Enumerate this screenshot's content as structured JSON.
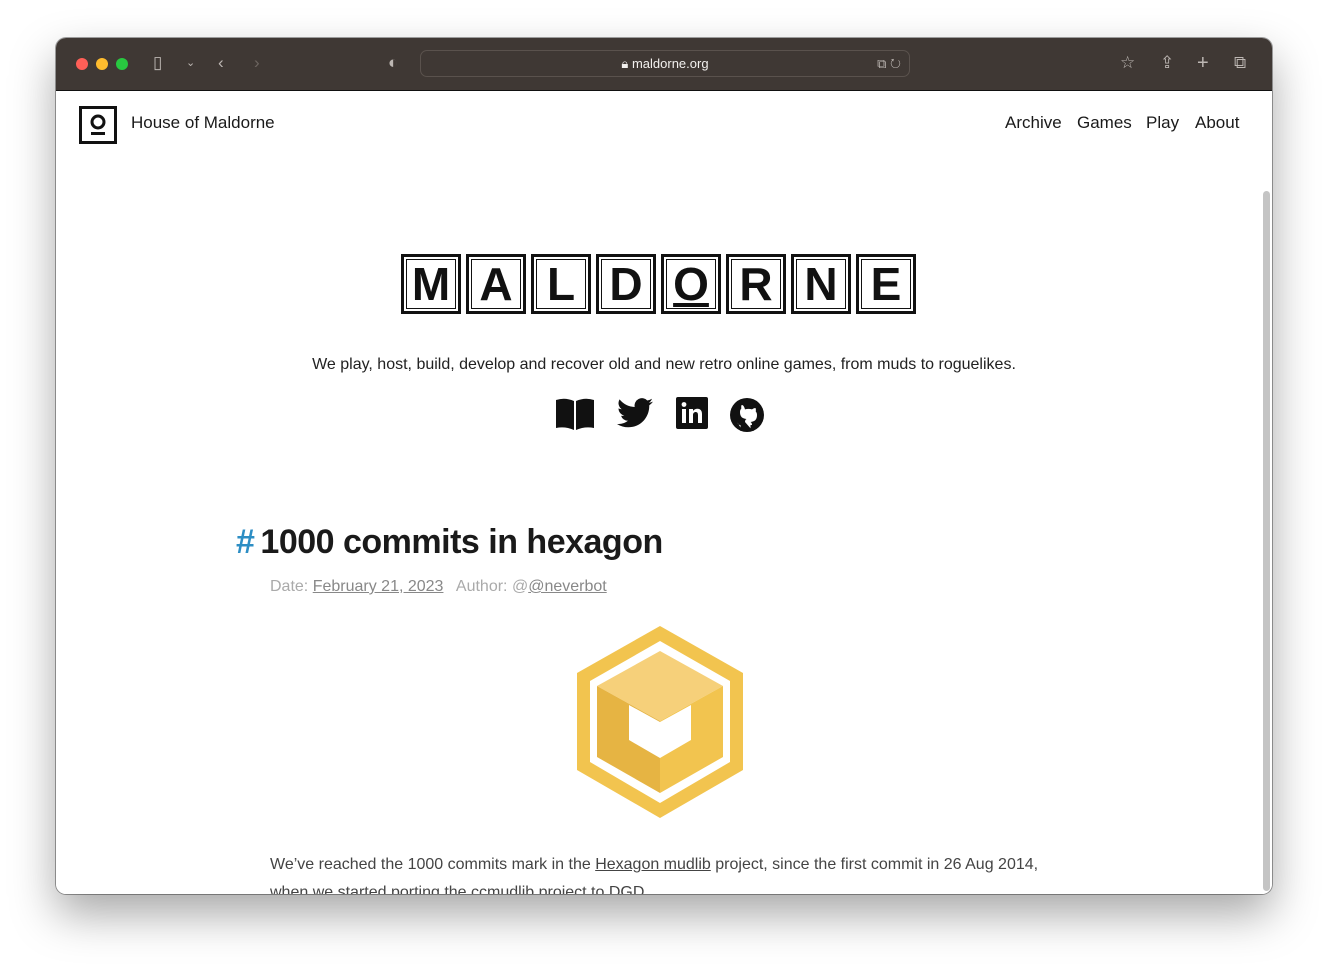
{
  "browser": {
    "url": "maldorne.org"
  },
  "site": {
    "name": "House of Maldorne",
    "nav": [
      "Archive",
      "Games",
      "Play",
      "About"
    ],
    "logo_letters": [
      "M",
      "A",
      "L",
      "D",
      "O",
      "R",
      "N",
      "E"
    ],
    "tagline": "We play, host, build, develop and recover old and new retro online games, from muds to roguelikes.",
    "social_icons": [
      "book-icon",
      "twitter-icon",
      "linkedin-icon",
      "github-icon"
    ]
  },
  "post": {
    "hash": "#",
    "title": "1000 commits in hexagon",
    "date_label": "Date:",
    "date": "February 21, 2023",
    "author_label": "Author:",
    "author": "@neverbot",
    "body_1": "We’ve reached the 1000 commits mark in the ",
    "body_link": "Hexagon mudlib",
    "body_2": " project, since the first commit in 26 Aug 2014,",
    "body_3": "when we started porting the ccmudlib project to DGD."
  },
  "colors": {
    "accent": "#2d8ec4",
    "hexagon": "#f2c44f",
    "titlebar": "#3f3834"
  }
}
